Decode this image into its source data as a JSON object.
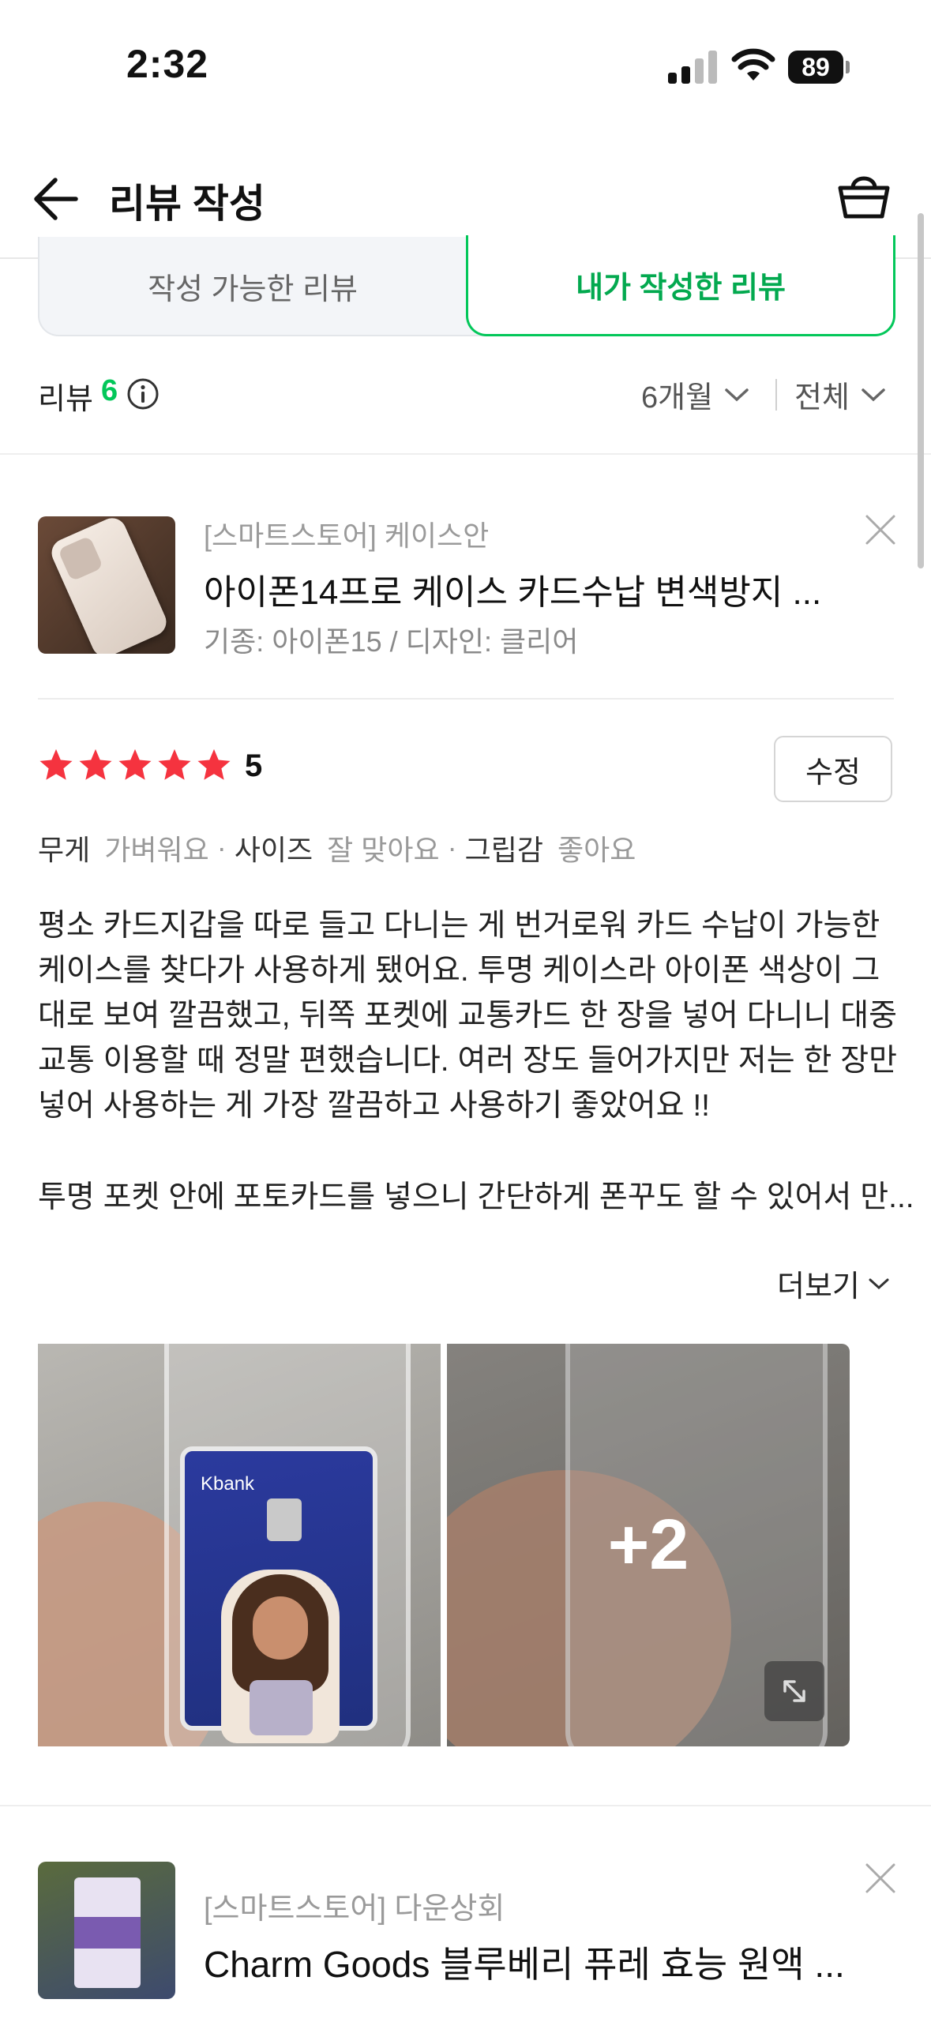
{
  "status_bar": {
    "time": "2:32",
    "battery": "89"
  },
  "header": {
    "title": "리뷰 작성",
    "back_icon": "back-arrow-icon",
    "cart_icon": "shopping-basket-icon"
  },
  "tabs": [
    {
      "label": "작성 가능한 리뷰",
      "active": false
    },
    {
      "label": "내가 작성한 리뷰",
      "active": true
    }
  ],
  "summary": {
    "label": "리뷰",
    "count": "6",
    "period": "6개월",
    "scope": "전체"
  },
  "reviews": [
    {
      "seller": "[스마트스토어] 케이스안",
      "product_name": "아이폰14프로 케이스 카드수납 변색방지 ...",
      "option": "기종: 아이폰15 / 디자인: 클리어",
      "rating": "5",
      "edit_label": "수정",
      "attributes": [
        {
          "key": "무게",
          "value": "가벼워요"
        },
        {
          "key": "사이즈",
          "value": "잘 맞아요"
        },
        {
          "key": "그립감",
          "value": "좋아요"
        }
      ],
      "body": "평소 카드지갑을 따로 들고 다니는 게 번거로워 카드 수납이 가능한 케이스를 찾다가 사용하게 됐어요. 투명 케이스라 아이폰 색상이 그대로 보여 깔끔했고, 뒤쪽 포켓에 교통카드 한 장을 넣어 다니니 대중교통 이용할 때 정말 편했습니다. 여러 장도 들어가지만 저는 한 장만 넣어 사용하는 게 가장 깔끔하고 사용하기 좋았어요 !!",
      "body_more": "투명 포켓 안에 포토카드를 넣으니 간단하게 폰꾸도 할 수 있어서 만...",
      "more_label": "더보기",
      "photo_card_brand": "Kbank",
      "photos_more": "+2"
    },
    {
      "seller": "[스마트스토어] 다운상회",
      "product_name": "Charm Goods 블루베리 퓨레 효능 원액 ..."
    }
  ],
  "colors": {
    "accent": "#03c75a",
    "star": "#f5333f"
  }
}
